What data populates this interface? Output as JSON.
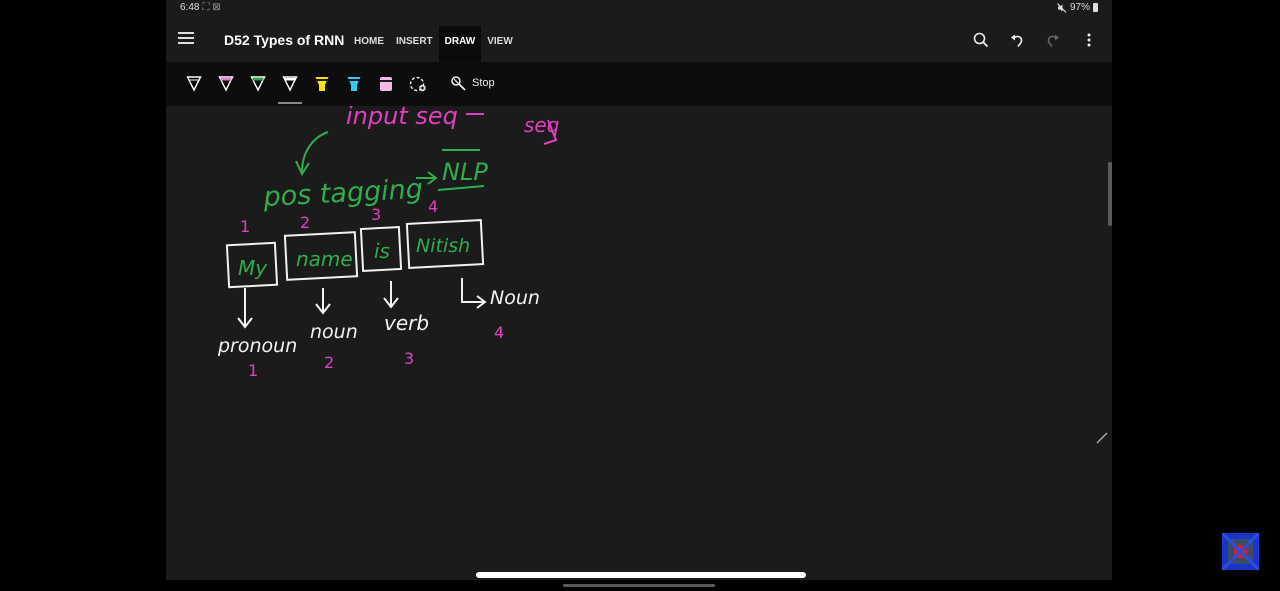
{
  "status_bar": {
    "time": "6:48",
    "status_icons": "⛶ ⊠",
    "mute_icon": "mute-icon",
    "battery": "97%"
  },
  "app_bar": {
    "menu_icon": "hamburger-menu-icon",
    "title": "D52 Types of RNN",
    "tabs": [
      {
        "label": "HOME",
        "active": false
      },
      {
        "label": "INSERT",
        "active": false
      },
      {
        "label": "DRAW",
        "active": true
      },
      {
        "label": "VIEW",
        "active": false
      }
    ],
    "actions": [
      "search-icon",
      "undo-icon",
      "redo-icon",
      "more-vert-icon"
    ]
  },
  "ribbon": {
    "pens": [
      {
        "name": "pen-black",
        "color": "#000000"
      },
      {
        "name": "pen-pink",
        "color": "#e27ad8"
      },
      {
        "name": "pen-green",
        "color": "#2ba84a"
      },
      {
        "name": "pen-white",
        "color": "#ffffff"
      },
      {
        "name": "highlighter-yellow",
        "color": "#f3e600"
      },
      {
        "name": "highlighter-cyan",
        "color": "#39c6f0"
      },
      {
        "name": "highlighter-light-pink",
        "color": "#f2b8e6"
      },
      {
        "name": "pen-settings-icon",
        "color": "#ffffff"
      }
    ],
    "stop_label": "Stop"
  },
  "canvas": {
    "ink": {
      "pink": "#e040c0",
      "green": "#2fae4e",
      "white": "#f2f2f2"
    },
    "top_text": "input seq",
    "top_right": "seq",
    "heading": "pos tagging",
    "heading_target": "NLP",
    "words": [
      {
        "index": "1",
        "word": "My",
        "tag": "pronoun",
        "tag_index": "1"
      },
      {
        "index": "2",
        "word": "name",
        "tag": "noun",
        "tag_index": "2"
      },
      {
        "index": "3",
        "word": "is",
        "tag": "verb",
        "tag_index": "3"
      },
      {
        "index": "4",
        "word": "Nitish",
        "tag": "Noun",
        "tag_index": "4"
      }
    ]
  },
  "overlay": {
    "logo_icon": "channel-logo-icon"
  }
}
